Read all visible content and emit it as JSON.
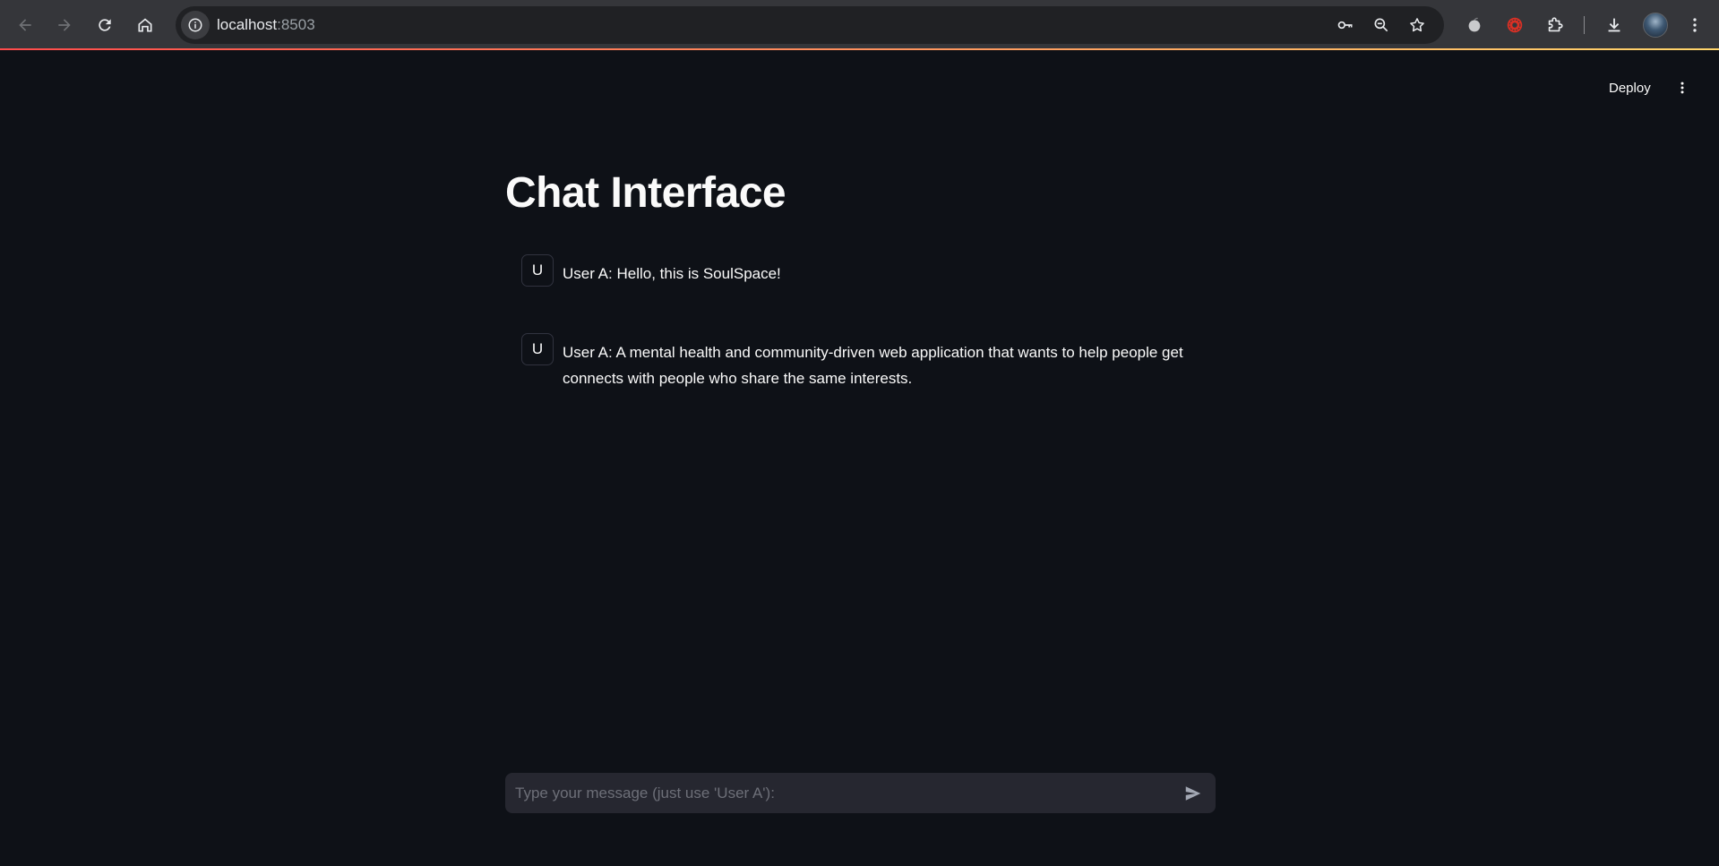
{
  "browser": {
    "url_host": "localhost",
    "url_port": ":8503",
    "icons": {
      "back": "back-arrow-icon",
      "forward": "forward-arrow-icon",
      "reload": "reload-icon",
      "home": "home-icon",
      "site_info": "info-icon",
      "password": "key-icon",
      "zoom": "zoom-icon",
      "bookmark": "star-icon",
      "extension_1": "extension-apple-icon",
      "extension_2": "extension-record-icon",
      "extensions": "puzzle-icon",
      "downloads": "download-icon",
      "profile": "avatar",
      "menu": "kebab-menu-icon"
    }
  },
  "header": {
    "deploy_label": "Deploy"
  },
  "main": {
    "title": "Chat Interface",
    "messages": [
      {
        "avatar": "U",
        "text": "User A: Hello, this is SoulSpace!"
      },
      {
        "avatar": "U",
        "text": "User A: A mental health and community-driven web application that wants to help people get connects with people who share the same interests."
      }
    ],
    "chat_input": {
      "placeholder": "Type your message (just use 'User A'):",
      "value": ""
    }
  },
  "colors": {
    "background": "#0e1117",
    "text": "#fafafa",
    "input_bg": "#262730",
    "accent_gradient_start": "#ff4b4b",
    "accent_gradient_end": "#ffd66b"
  }
}
